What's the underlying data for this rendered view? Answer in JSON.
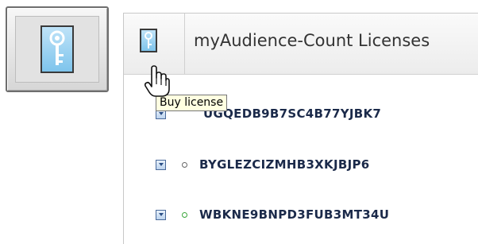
{
  "panel": {
    "title": "myAudience-Count Licenses"
  },
  "tooltip": "Buy license",
  "licenses": [
    {
      "code": "UGQEDB9B7SC4B77YJBK7",
      "status": "partial"
    },
    {
      "code": "BYGLEZCIZMHB3XKJBJP6",
      "status": "inactive"
    },
    {
      "code": "WBKNE9BNPD3FUB3MT34U",
      "status": "active"
    }
  ],
  "colors": {
    "status_inactive": "#666666",
    "status_active": "#3aa63a",
    "key_fill": "#7ec4ec",
    "tooltip_bg": "#ffffe1"
  },
  "icons": {
    "big_button": "key-icon",
    "header_button": "key-icon",
    "cursor": "hand-pointer-icon",
    "row_toggle": "expand-toggle-icon"
  }
}
